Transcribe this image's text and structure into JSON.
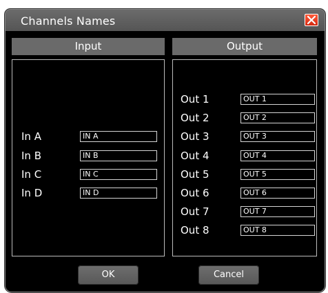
{
  "window": {
    "title": "Channels Names"
  },
  "input": {
    "header": "Input",
    "rows": [
      {
        "label": "In A",
        "value": "IN A"
      },
      {
        "label": "In B",
        "value": "IN B"
      },
      {
        "label": "In C",
        "value": "IN C"
      },
      {
        "label": "In D",
        "value": "IN D"
      }
    ]
  },
  "output": {
    "header": "Output",
    "rows": [
      {
        "label": "Out 1",
        "value": "OUT 1"
      },
      {
        "label": "Out 2",
        "value": "OUT 2"
      },
      {
        "label": "Out 3",
        "value": "OUT 3"
      },
      {
        "label": "Out 4",
        "value": "OUT 4"
      },
      {
        "label": "Out 5",
        "value": "OUT 5"
      },
      {
        "label": "Out 6",
        "value": "OUT 6"
      },
      {
        "label": "Out 7",
        "value": "OUT 7"
      },
      {
        "label": "Out 8",
        "value": "OUT 8"
      }
    ]
  },
  "buttons": {
    "ok": "OK",
    "cancel": "Cancel"
  },
  "colors": {
    "titlebar": "#5e5e5e",
    "close": "#e03a1e",
    "panel_header": "#6a6a6a",
    "background": "#000000"
  },
  "icons": {
    "close": "close-icon"
  }
}
